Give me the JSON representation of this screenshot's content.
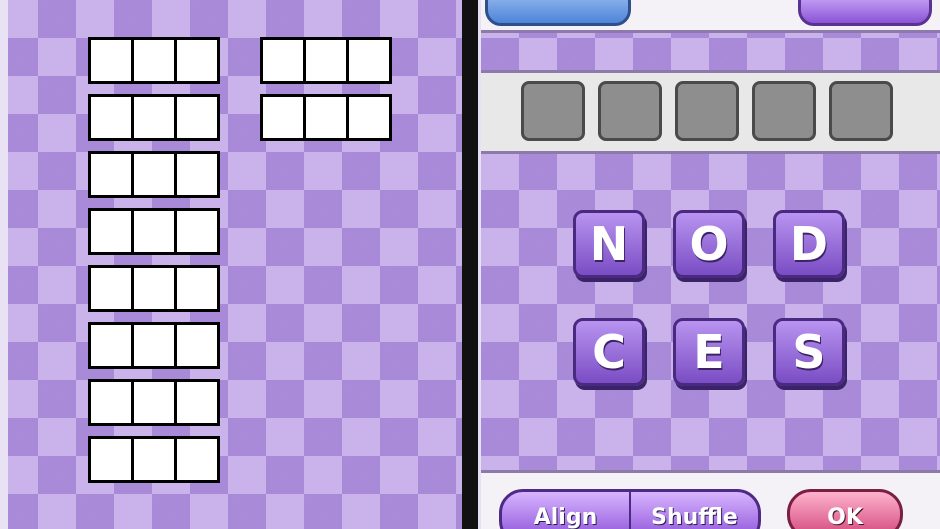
{
  "puzzle": {
    "letters": [
      "N",
      "O",
      "D",
      "C",
      "E",
      "S"
    ],
    "answer_slot_count": 5,
    "word_slots_left_column": 8,
    "word_slots_right_column": 2,
    "letters_per_word": 3
  },
  "buttons": {
    "align": "Align",
    "shuffle": "Shuffle",
    "ok": "OK"
  },
  "colors": {
    "background": "#c9b3ea",
    "diamond": "#a98ad8",
    "tile": "#9b6fe0",
    "ok_button": "#e86a98"
  }
}
